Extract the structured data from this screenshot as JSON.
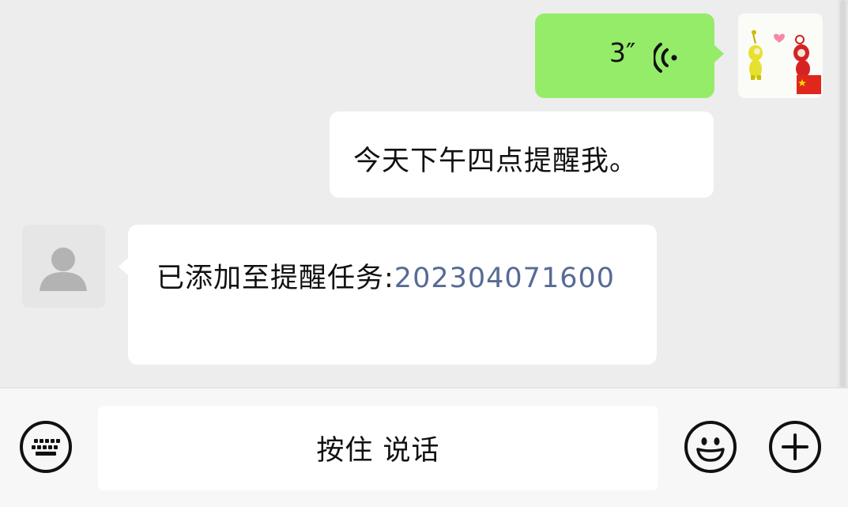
{
  "messages": [
    {
      "type": "voice",
      "sender": "me",
      "duration": "3″",
      "bubble_color": "#95ec69"
    },
    {
      "type": "text",
      "sender": "me",
      "text": "今天下午四点提醒我。"
    },
    {
      "type": "text",
      "sender": "bot",
      "text": "已添加至提醒任务:",
      "link_text": "202304071600",
      "link_color": "#576b95"
    }
  ],
  "input_bar": {
    "hold_to_talk": "按住 说话",
    "icons": [
      "keyboard-icon",
      "emoji-icon",
      "plus-icon"
    ]
  }
}
